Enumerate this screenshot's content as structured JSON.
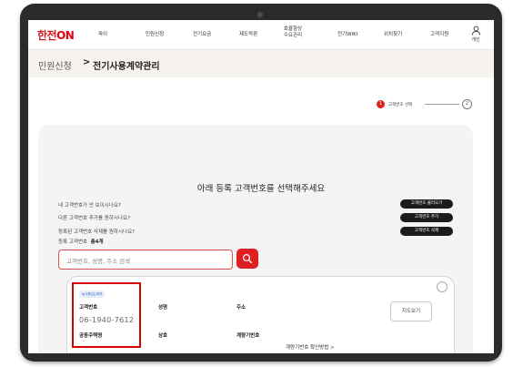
{
  "nav": {
    "logo_main": "한전",
    "logo_on": "ON",
    "items": [
      "파이",
      "민원신청",
      "전기요금",
      "제도락판"
    ],
    "item_two_line": [
      "효율향상",
      "수요관리"
    ],
    "items_right": [
      "전기WIKI",
      "위치찾기",
      "고객지원"
    ],
    "user_label": "개인"
  },
  "breadcrumb": {
    "parent": "민원신청",
    "separator": ">",
    "current": "전기사용계약관리"
  },
  "steps": {
    "step1_number": "1",
    "step1_label": "고객번호 선택",
    "step2_number": "2"
  },
  "main": {
    "title": "아래 등록 고객번호를 선택해주세요",
    "questions": [
      "내 고객번호가 안 보이시나요?",
      "다른 고객번호 추가를 원하시나요?",
      "등록된 고객번호 삭제를 원하시나요?"
    ],
    "buttons": [
      "고객번호 불러오기",
      "고객번호 추가",
      "고객번호 삭제"
    ],
    "registered_label": "등록 고객번호",
    "registered_count": "총4개",
    "search_placeholder": "고객번호, 성명, 주소 검색"
  },
  "card": {
    "tag": "농사용(갑)계약",
    "customer_no_label": "고객번호",
    "customer_no": "06-1940-7612",
    "name_label": "성명",
    "address_label": "주소",
    "housing_type": "공동주택명",
    "business_label": "상호",
    "meter_label": "계량기번호",
    "meter_link": "계량기번호 확인방법 >",
    "map_button": "지도보기"
  },
  "colors": {
    "brand_red": "#e02020",
    "highlight_border": "#d40000",
    "title_band": "#f6f3ee"
  }
}
